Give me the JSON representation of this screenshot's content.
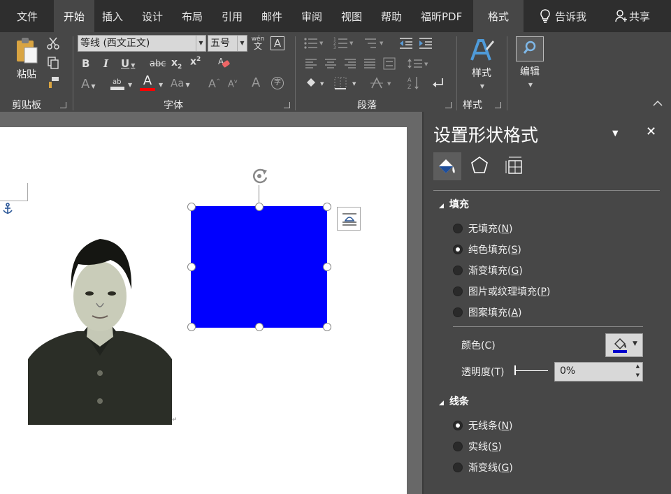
{
  "tabs": [
    {
      "label": "文件",
      "key": "file"
    },
    {
      "label": "开始",
      "key": "home",
      "active": true
    },
    {
      "label": "插入",
      "key": "insert"
    },
    {
      "label": "设计",
      "key": "design"
    },
    {
      "label": "布局",
      "key": "layout"
    },
    {
      "label": "引用",
      "key": "references"
    },
    {
      "label": "邮件",
      "key": "mailings"
    },
    {
      "label": "审阅",
      "key": "review"
    },
    {
      "label": "视图",
      "key": "view"
    },
    {
      "label": "帮助",
      "key": "help"
    },
    {
      "label": "福昕PDF",
      "key": "foxit"
    },
    {
      "label": "格式",
      "key": "format"
    }
  ],
  "tell_me": "告诉我",
  "share": "共享",
  "ribbon": {
    "clipboard": {
      "paste": "粘贴",
      "label": "剪贴板"
    },
    "font": {
      "family": "等线 (西文正文)",
      "size": "五号",
      "label": "字体",
      "phonetic": "wén",
      "phonetic_char": "文"
    },
    "paragraph": {
      "label": "段落"
    },
    "styles": {
      "button": "样式",
      "label": "样式"
    },
    "editing": {
      "button": "编辑"
    }
  },
  "pane": {
    "title": "设置形状格式",
    "fill_section": "填充",
    "fill_options": [
      {
        "label": "无填充",
        "key": "N",
        "selected": false
      },
      {
        "label": "纯色填充",
        "key": "S",
        "selected": true
      },
      {
        "label": "渐变填充",
        "key": "G",
        "selected": false
      },
      {
        "label": "图片或纹理填充",
        "key": "P",
        "selected": false
      },
      {
        "label": "图案填充",
        "key": "A",
        "selected": false
      }
    ],
    "color_label": "颜色(C)",
    "transparency_label": "透明度(T)",
    "transparency_value": "0%",
    "line_section": "线条",
    "line_options": [
      {
        "label": "无线条",
        "key": "N",
        "selected": true
      },
      {
        "label": "实线",
        "key": "S",
        "selected": false
      },
      {
        "label": "渐变线",
        "key": "G",
        "selected": false
      }
    ]
  },
  "colors": {
    "shape_fill": "#0000ff",
    "font_color_bar": "#ff0000",
    "fill_color_bar": "#0000cc"
  }
}
